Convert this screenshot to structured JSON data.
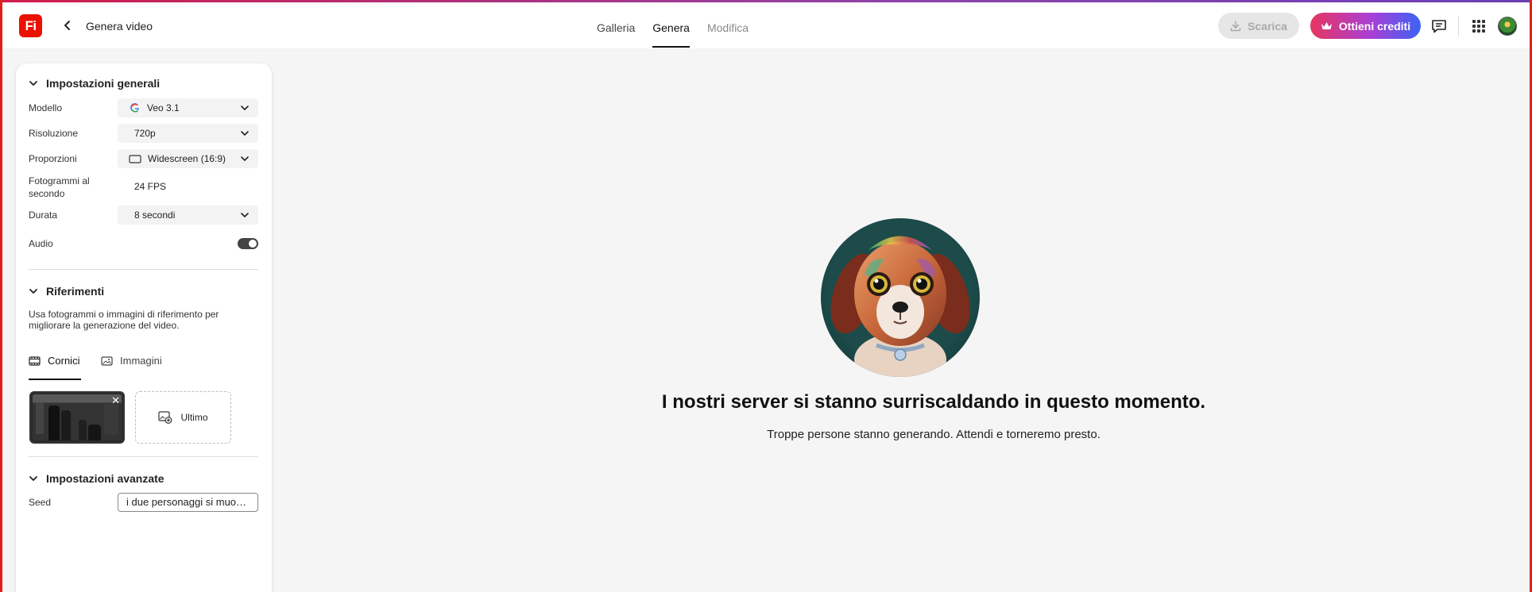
{
  "header": {
    "logo_text": "Fi",
    "title": "Genera video",
    "tabs": [
      {
        "label": "Galleria"
      },
      {
        "label": "Genera"
      },
      {
        "label": "Modifica"
      }
    ],
    "download_label": "Scarica",
    "credits_label": "Ottieni crediti"
  },
  "panel": {
    "general": {
      "title": "Impostazioni generali",
      "model_label": "Modello",
      "model_value": "Veo 3.1",
      "resolution_label": "Risoluzione",
      "resolution_value": "720p",
      "aspect_label": "Proporzioni",
      "aspect_value": "Widescreen (16:9)",
      "fps_label": "Fotogrammi al secondo",
      "fps_value": "24 FPS",
      "duration_label": "Durata",
      "duration_value": "8 secondi",
      "audio_label": "Audio",
      "audio_on": true
    },
    "references": {
      "title": "Riferimenti",
      "description": "Usa fotogrammi o immagini di riferimento per migliorare la generazione del video.",
      "tab_frames": "Cornici",
      "tab_images": "Immagini",
      "last_slot_label": "Ultimo"
    },
    "advanced": {
      "title": "Impostazioni avanzate",
      "seed_label": "Seed",
      "seed_value": "i due personaggi si muovono"
    }
  },
  "main": {
    "title": "I nostri server si stanno surriscaldando in questo momento.",
    "subtitle": "Troppe persone stanno generando. Attendi e torneremo presto."
  },
  "colors": {
    "brand_red": "#eb1000",
    "credits_gradient_start": "#e6355f",
    "credits_gradient_end": "#3b63f5"
  }
}
